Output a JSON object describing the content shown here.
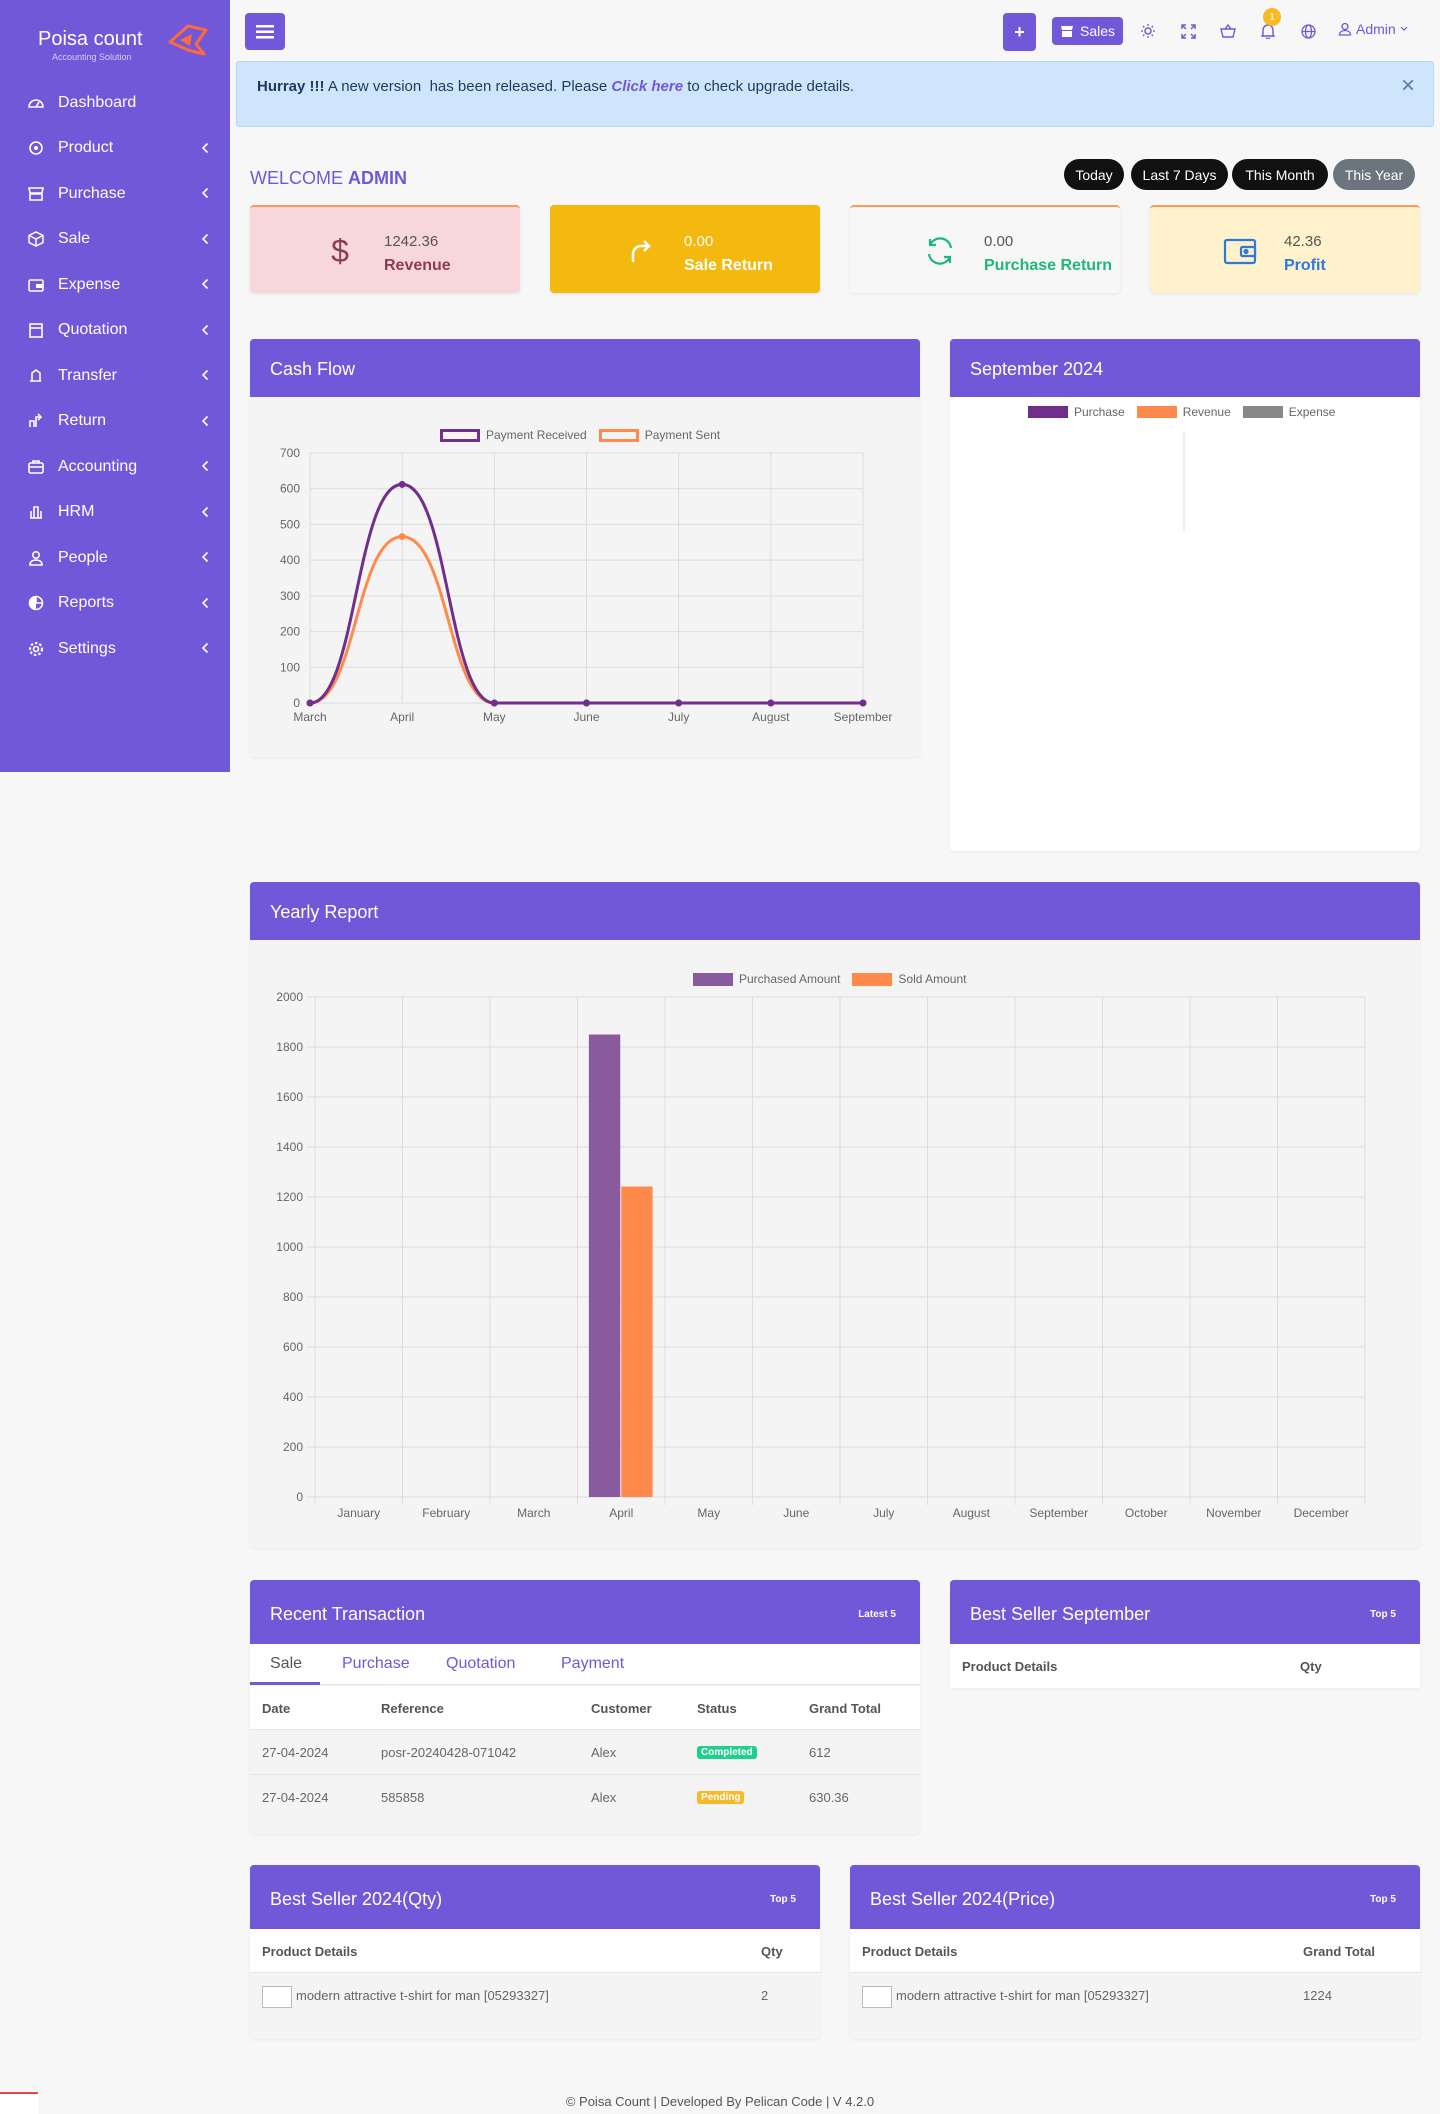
{
  "brand": {
    "name": "Poisa count",
    "tagline": "Accounting Solution"
  },
  "sidebar": {
    "items": [
      {
        "label": "Dashboard",
        "icon": "dashboard-icon",
        "has_children": false
      },
      {
        "label": "Product",
        "icon": "product-icon",
        "has_children": true
      },
      {
        "label": "Purchase",
        "icon": "purchase-icon",
        "has_children": true
      },
      {
        "label": "Sale",
        "icon": "sale-icon",
        "has_children": true
      },
      {
        "label": "Expense",
        "icon": "expense-icon",
        "has_children": true
      },
      {
        "label": "Quotation",
        "icon": "quotation-icon",
        "has_children": true
      },
      {
        "label": "Transfer",
        "icon": "transfer-icon",
        "has_children": true
      },
      {
        "label": "Return",
        "icon": "return-icon",
        "has_children": true
      },
      {
        "label": "Accounting",
        "icon": "accounting-icon",
        "has_children": true
      },
      {
        "label": "HRM",
        "icon": "hrm-icon",
        "has_children": true
      },
      {
        "label": "People",
        "icon": "people-icon",
        "has_children": true
      },
      {
        "label": "Reports",
        "icon": "reports-icon",
        "has_children": true
      },
      {
        "label": "Settings",
        "icon": "settings-icon",
        "has_children": true
      }
    ]
  },
  "header": {
    "add_label": "+",
    "sales_label": "Sales",
    "notification_count": "1",
    "user_label": "Admin"
  },
  "alert": {
    "strong": "Hurray !!!",
    "text_before": " A new version  has been released. Please ",
    "link": "Click here",
    "text_after": " to check upgrade details.",
    "close": "×"
  },
  "welcome": {
    "prefix": "WELCOME ",
    "name": "ADMIN"
  },
  "periods": [
    "Today",
    "Last 7 Days",
    "This Month",
    "This Year"
  ],
  "stats": [
    {
      "value": "1242.36",
      "label": "Revenue",
      "icon": "dollar-icon",
      "bg": "#f8d7da",
      "label_color": "#8e3b54"
    },
    {
      "value": "0.00",
      "label": "Sale Return",
      "icon": "return-arrow-icon",
      "bg": "#f4b90e",
      "label_color": "#ffffff"
    },
    {
      "value": "0.00",
      "label": "Purchase Return",
      "icon": "refresh-icon",
      "bg": "#f7f7f7",
      "label_color": "#1fb87a"
    },
    {
      "value": "42.36",
      "label": "Profit",
      "icon": "wallet-icon",
      "bg": "#fff1cc",
      "label_color": "#2d7bd8"
    }
  ],
  "cash_flow": {
    "title": "Cash Flow",
    "chart_data": {
      "type": "line",
      "categories": [
        "March",
        "April",
        "May",
        "June",
        "July",
        "August",
        "September"
      ],
      "series": [
        {
          "name": "Payment Received",
          "values": [
            0,
            612,
            0,
            0,
            0,
            0,
            0
          ],
          "color": "#6f2f8a"
        },
        {
          "name": "Payment Sent",
          "values": [
            0,
            466,
            0,
            0,
            0,
            0,
            0
          ],
          "color": "#ff8a4c"
        }
      ],
      "ylim": [
        0,
        700
      ],
      "yticks": [
        0,
        100,
        200,
        300,
        400,
        500,
        600,
        700
      ],
      "grid": true,
      "legend": "top"
    }
  },
  "month_panel": {
    "title": "September 2024",
    "chart_data": {
      "type": "pie",
      "legend": [
        {
          "name": "Purchase",
          "color": "#6f2f8a"
        },
        {
          "name": "Revenue",
          "color": "#ff8a4c"
        },
        {
          "name": "Expense",
          "color": "#888888"
        }
      ],
      "values": [
        0,
        0,
        0
      ]
    }
  },
  "yearly": {
    "title": "Yearly Report",
    "chart_data": {
      "type": "bar",
      "categories": [
        "January",
        "February",
        "March",
        "April",
        "May",
        "June",
        "July",
        "August",
        "September",
        "October",
        "November",
        "December"
      ],
      "series": [
        {
          "name": "Purchased Amount",
          "values": [
            0,
            0,
            0,
            1850,
            0,
            0,
            0,
            0,
            0,
            0,
            0,
            0
          ],
          "color": "#8a5a9e"
        },
        {
          "name": "Sold Amount",
          "values": [
            0,
            0,
            0,
            1242,
            0,
            0,
            0,
            0,
            0,
            0,
            0,
            0
          ],
          "color": "#ff8a4c"
        }
      ],
      "ylim": [
        0,
        2000
      ],
      "yticks": [
        0,
        200,
        400,
        600,
        800,
        1000,
        1200,
        1400,
        1600,
        1800,
        2000
      ],
      "grid": true,
      "legend": "top"
    }
  },
  "recent": {
    "title": "Recent Transaction",
    "badge": "Latest 5",
    "tabs": [
      "Sale",
      "Purchase",
      "Quotation",
      "Payment"
    ],
    "columns": [
      "Date",
      "Reference",
      "Customer",
      "Status",
      "Grand Total"
    ],
    "rows": [
      {
        "date": "27-04-2024",
        "ref": "posr-20240428-071042",
        "customer": "Alex",
        "status": "Completed",
        "status_color": "#1fcf8e",
        "total": "612"
      },
      {
        "date": "27-04-2024",
        "ref": "585858",
        "customer": "Alex",
        "status": "Pending",
        "status_color": "#f7b924",
        "total": "630.36"
      }
    ]
  },
  "best_month": {
    "title": "Best Seller September",
    "badge": "Top 5",
    "columns": [
      "Product Details",
      "Qty"
    ]
  },
  "best_qty": {
    "title": "Best Seller 2024(Qty)",
    "badge": "Top 5",
    "columns": [
      "Product Details",
      "Qty"
    ],
    "rows": [
      {
        "product": "modern attractive t-shirt for man [05293327]",
        "value": "2"
      }
    ]
  },
  "best_price": {
    "title": "Best Seller 2024(Price)",
    "badge": "Top 5",
    "columns": [
      "Product Details",
      "Grand Total"
    ],
    "rows": [
      {
        "product": "modern attractive t-shirt for man [05293327]",
        "value": "1224"
      }
    ]
  },
  "footer": "© Poisa Count | Developed By Pelican Code | V 4.2.0",
  "colors": {
    "primary": "#7158d9",
    "accent": "#ff8a4c"
  }
}
